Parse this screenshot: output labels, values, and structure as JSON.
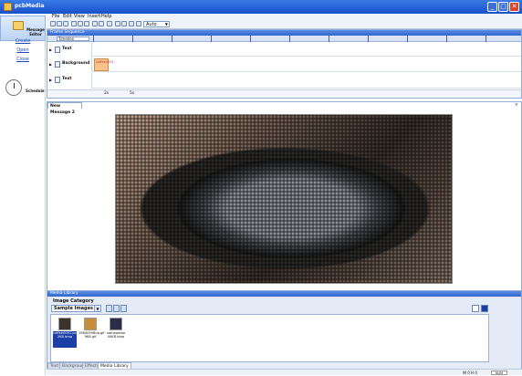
{
  "window": {
    "title": "pcbMedia",
    "minimize": "_",
    "maximize": "□",
    "close": "✕"
  },
  "sidebar": {
    "nav_label": "Message Editor",
    "links": [
      "Create",
      "Open",
      "Close"
    ],
    "schedule_label": "Schedule"
  },
  "menu": [
    "File",
    "Edit",
    "View",
    "Insert",
    "Help"
  ],
  "toolbar": {
    "zoom_value": "Auto"
  },
  "frame_sequence": {
    "title": "Frame Sequence",
    "timeline_label": "Timeline",
    "rows": [
      {
        "name": "Text"
      },
      {
        "name": "Background",
        "cell_label": "coffee0001"
      },
      {
        "name": "Text"
      }
    ],
    "seconds": [
      "2s",
      "5s"
    ]
  },
  "message": {
    "tab_label": "New Message 2",
    "close": "×"
  },
  "media_library": {
    "title": "Media Library",
    "category_label": "Image Category",
    "category_value": "Sample Images",
    "items": [
      {
        "caption": "coffee0001.png 2KB bmp",
        "selected": true
      },
      {
        "caption": "1984095Bno.gif 9KB gif",
        "selected": false
      },
      {
        "caption": "nameaddre 44KB bmp",
        "selected": false
      }
    ],
    "tabs": [
      "Text",
      "Background",
      "Effects",
      "Media Library"
    ]
  },
  "status": {
    "zoom": "W 0 H 0",
    "mode": "NUM"
  },
  "colors": {
    "title_bar": "#2a63d9",
    "panel_header": "#3f75d8",
    "selection": "#1b3fa6"
  }
}
